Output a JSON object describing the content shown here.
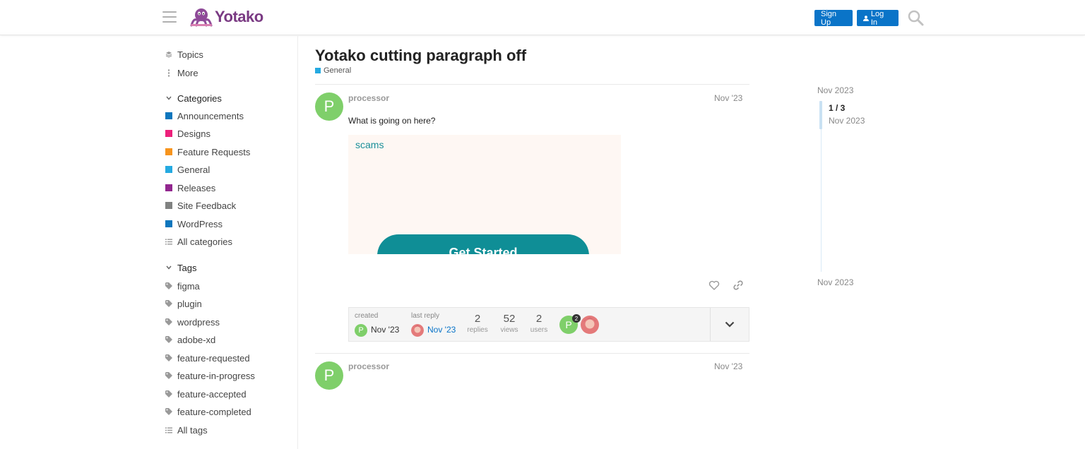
{
  "header": {
    "logo_text": "Yotako",
    "signup_label": "Sign Up",
    "login_label": "Log In"
  },
  "sidebar": {
    "top_items": [
      {
        "label": "Topics",
        "icon": "layers-icon"
      },
      {
        "label": "More",
        "icon": "vertical-ellipsis-icon"
      }
    ],
    "categories_heading": "Categories",
    "categories": [
      {
        "label": "Announcements",
        "color": "#0e76bd"
      },
      {
        "label": "Designs",
        "color": "#ed207b"
      },
      {
        "label": "Feature Requests",
        "color": "#f7941d"
      },
      {
        "label": "General",
        "color": "#25aae1"
      },
      {
        "label": "Releases",
        "color": "#92278f"
      },
      {
        "label": "Site Feedback",
        "color": "#808281"
      },
      {
        "label": "WordPress",
        "color": "#0e76bd"
      }
    ],
    "all_categories_label": "All categories",
    "tags_heading": "Tags",
    "tags": [
      "figma",
      "plugin",
      "wordpress",
      "adobe-xd",
      "feature-requested",
      "feature-in-progress",
      "feature-accepted",
      "feature-completed"
    ],
    "all_tags_label": "All tags"
  },
  "topic": {
    "title": "Yotako cutting paragraph off",
    "category": "General",
    "category_color": "#25aae1"
  },
  "posts": [
    {
      "avatar_letter": "P",
      "avatar_color": "#7fcf6a",
      "username": "processor",
      "date": "Nov '23",
      "text": "What is going on here?",
      "embed_word": "scams",
      "embed_button": "Get Started"
    },
    {
      "avatar_letter": "P",
      "avatar_color": "#7fcf6a",
      "username": "processor",
      "date": "Nov '23"
    }
  ],
  "topic_map": {
    "created_label": "created",
    "created_value": "Nov '23",
    "created_avatar_letter": "P",
    "last_reply_label": "last reply",
    "last_reply_value": "Nov '23",
    "replies_count": "2",
    "replies_label": "replies",
    "views_count": "52",
    "views_label": "views",
    "users_count": "2",
    "users_label": "users",
    "participant_avatar_letter": "P",
    "participant_post_count": "2"
  },
  "timeline": {
    "start_date": "Nov 2023",
    "position": "1 / 3",
    "position_date": "Nov 2023",
    "end_date": "Nov 2023"
  }
}
